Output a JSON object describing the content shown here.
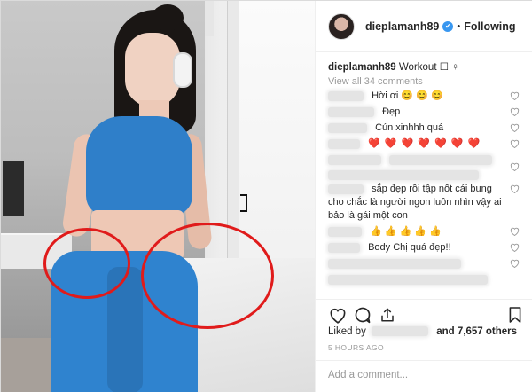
{
  "post": {
    "username": "dieplamanh89",
    "follow_state": "Following",
    "dot": "•",
    "verified_glyph": "✔",
    "caption_user": "dieplamanh89",
    "caption_text": "Workout ☐ ♀",
    "view_all": "View all 34 comments"
  },
  "comments": [
    {
      "text": "Hời ơi 😊 😊 😊"
    },
    {
      "text": "Đẹp"
    },
    {
      "text": "Cún xinhhh quá"
    },
    {
      "text": "❤️ ❤️ ❤️ ❤️ ❤️ ❤️ ❤️"
    },
    {
      "text": "sắp đẹp rồi tập nốt cái bung cho chắc là người ngon luôn nhìn vậy ai bảo là gái một con"
    },
    {
      "text": "👍 👍 👍 👍 👍"
    },
    {
      "text": "Body Chị quá đẹp!!"
    }
  ],
  "likes": {
    "prefix": "Liked by",
    "suffix": "and 7,657 others"
  },
  "time_ago": "5 HOURS AGO",
  "add_comment_placeholder": "Add a comment...",
  "colors": {
    "annotation": "#e01b1b",
    "verified": "#3897f0",
    "outfit": "#2f7fc9"
  }
}
